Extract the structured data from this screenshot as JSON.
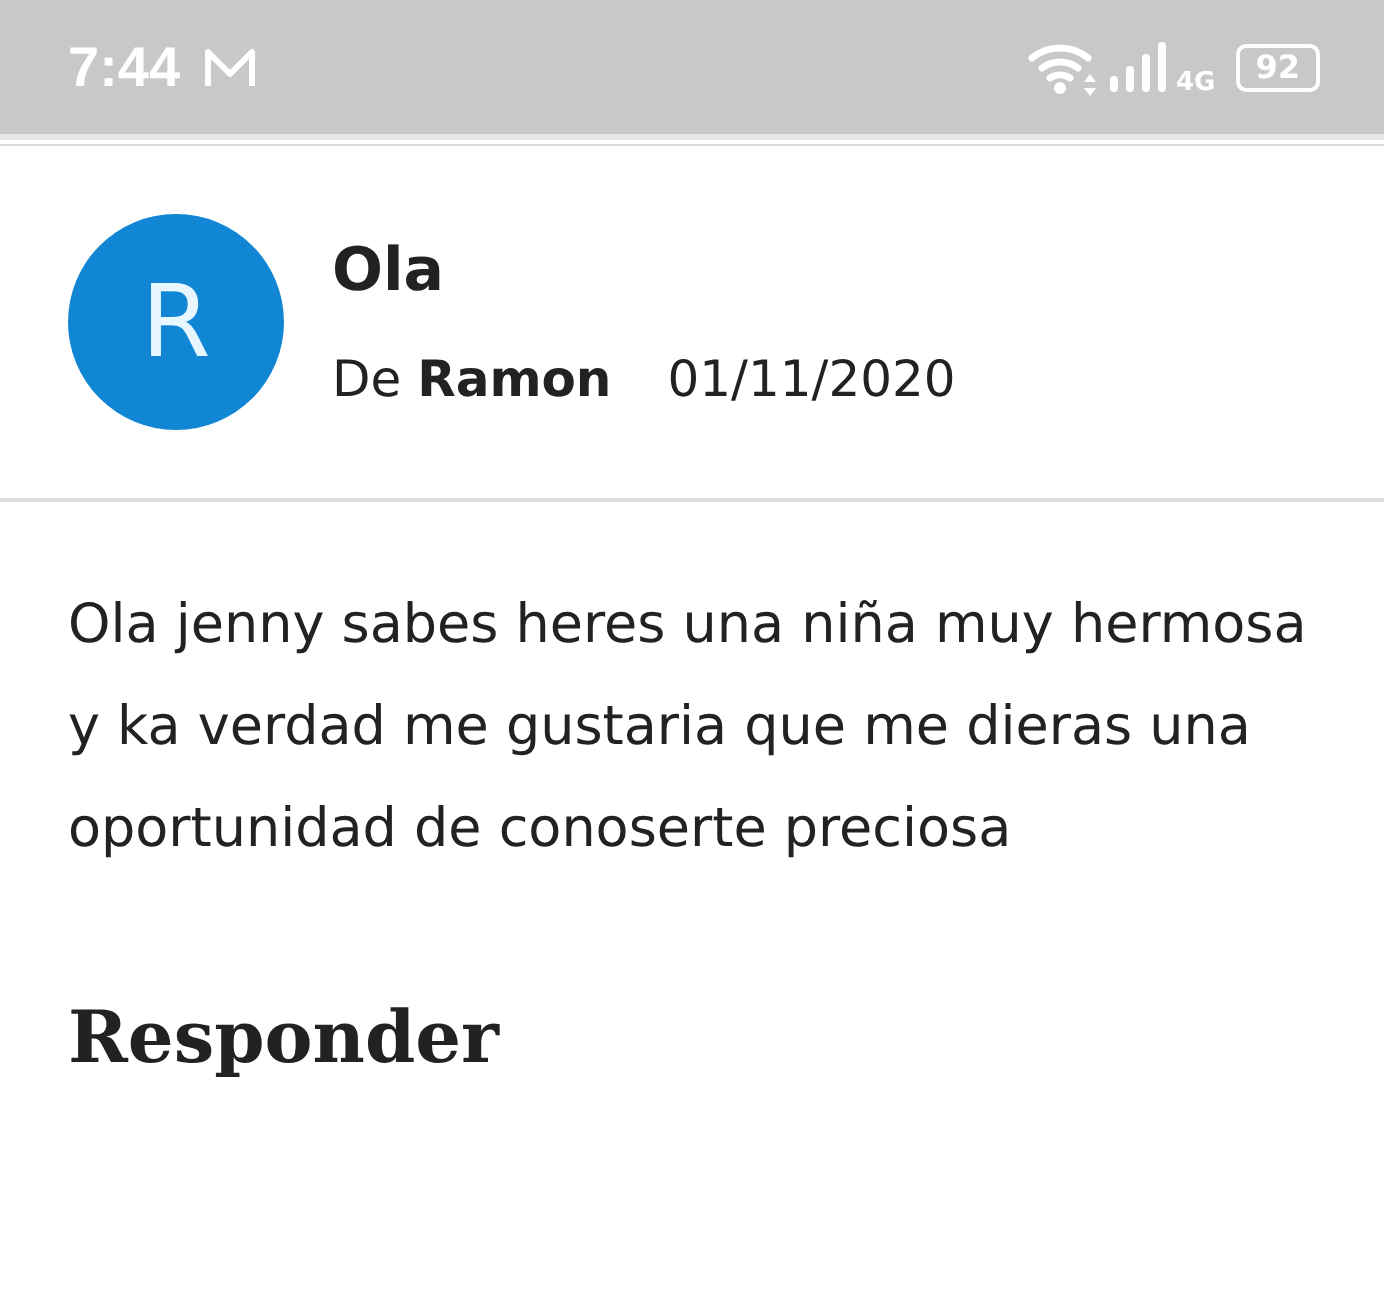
{
  "status_bar": {
    "time": "7:44",
    "network": "4G",
    "battery": "92"
  },
  "message": {
    "avatar_letter": "R",
    "subject": "Ola",
    "sender": "De **Ramon**",
    "date": "01/11/2020",
    "body": "Ola jenny sabes heres una niña muy hermosa y ka verdad me gustaria que me dieras una oportunidad de conoserte preciosa"
  },
  "reply_heading": "Responder"
}
